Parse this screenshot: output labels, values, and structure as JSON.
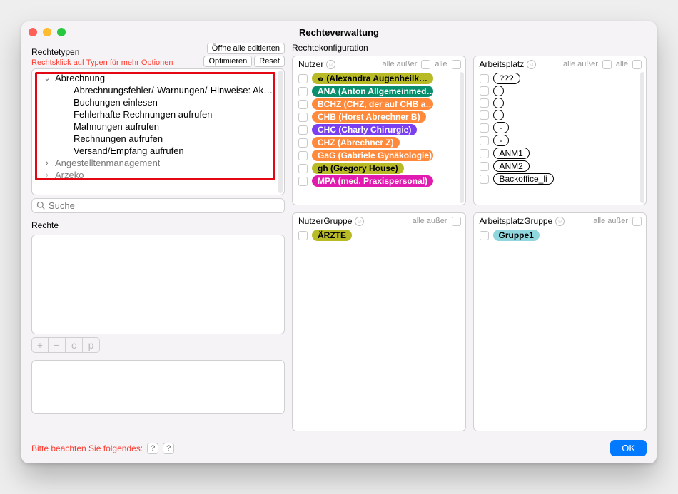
{
  "window": {
    "title": "Rechteverwaltung"
  },
  "left": {
    "typen_label": "Rechtetypen",
    "hint": "Rechtsklick auf Typen für mehr Optionen",
    "buttons": {
      "open_all": "Öffne alle editierten",
      "optimize": "Optimieren",
      "reset": "Reset"
    },
    "tree": {
      "parent": "Abrechnung",
      "items": [
        "Abrechnungsfehler/-Warnungen/-Hinweise: Ak…",
        "Buchungen einlesen",
        "Fehlerhafte Rechnungen aufrufen",
        "Mahnungen aufrufen",
        "Rechnungen aufrufen",
        "Versand/Empfang aufrufen"
      ],
      "collapsed1": "Angestelltenmanagement",
      "collapsed2": "Arzeko"
    },
    "search": {
      "placeholder": "Suche"
    },
    "rechte_label": "Rechte",
    "footer": {
      "note": "Bitte beachten Sie folgendes:",
      "q": "?"
    }
  },
  "right": {
    "title": "Rechtekonfiguration",
    "nutzer": {
      "label": "Nutzer",
      "filters": {
        "alle_ausser": "alle außer",
        "alle": "alle"
      },
      "items": [
        {
          "text": " (Alexandra Augenheilk…",
          "eye": true,
          "color": "#b8bb26",
          "fg": "#000"
        },
        {
          "text": "ANA (Anton Allgemeinmed…",
          "color": "#0a8f6e"
        },
        {
          "text": "BCHZ (CHZ, der auf CHB a…",
          "color": "#ff8a3c"
        },
        {
          "text": "CHB (Horst Abrechner B)",
          "color": "#ff8a3c"
        },
        {
          "text": "CHC (Charly Chirurgie)",
          "color": "#7a3ff0"
        },
        {
          "text": "CHZ (Abrechner Z)",
          "color": "#ff8a3c"
        },
        {
          "text": "GaG (Gabriele Gynäkologie)",
          "color": "#ff8a3c"
        },
        {
          "text": "gh (Gregory House)",
          "color": "#b8bb26",
          "fg": "#000"
        },
        {
          "text": "MPA (med. Praxispersonal)",
          "color": "#e21bb0"
        }
      ]
    },
    "arbeitsplatz": {
      "label": "Arbeitsplatz",
      "items": [
        {
          "kind": "pill",
          "text": "???"
        },
        {
          "kind": "circle"
        },
        {
          "kind": "circle"
        },
        {
          "kind": "circle"
        },
        {
          "kind": "pill",
          "text": "-"
        },
        {
          "kind": "pill",
          "text": "-"
        },
        {
          "kind": "pill",
          "text": "ANM1"
        },
        {
          "kind": "pill",
          "text": "ANM2"
        },
        {
          "kind": "pill",
          "text": "Backoffice_li"
        }
      ]
    },
    "nutzergruppe": {
      "label": "NutzerGruppe",
      "item": "ÄRZTE",
      "color": "#b8bb26"
    },
    "arbeitsplatzgruppe": {
      "label": "ArbeitsplatzGruppe",
      "item": "Gruppe1",
      "color": "#8fd6dd"
    },
    "ok": "OK"
  },
  "pm": {
    "plus": "+",
    "minus": "−",
    "c": "c",
    "p": "p"
  }
}
